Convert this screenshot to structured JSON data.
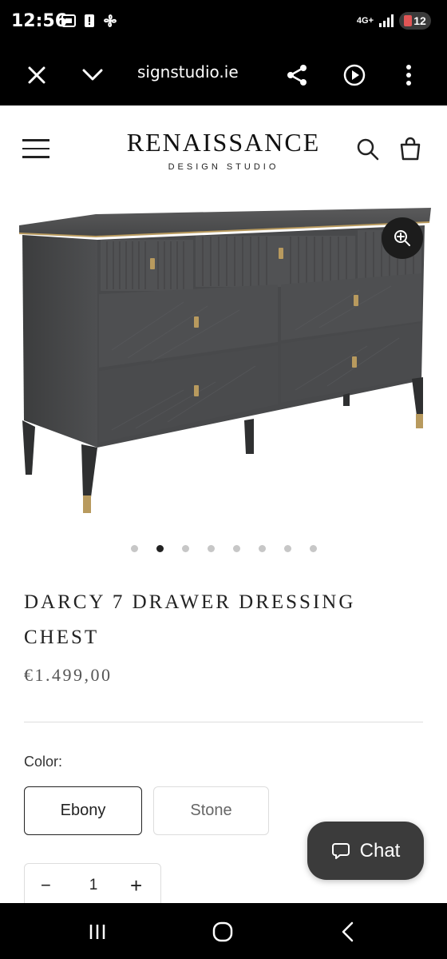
{
  "status_bar": {
    "time": "12:56",
    "network": "4G+",
    "battery_level": "12",
    "icons": [
      "screen-record-icon",
      "alert-icon",
      "fan-icon",
      "signal-icon",
      "battery-icon"
    ]
  },
  "browser": {
    "url_text": "signstudio.ie",
    "buttons": [
      "close-icon",
      "chevron-down-icon",
      "share-icon",
      "play-icon",
      "more-vertical-icon"
    ]
  },
  "header": {
    "brand_name": "RENAISSANCE",
    "brand_subtitle": "DESIGN STUDIO",
    "icons": [
      "menu-icon",
      "search-icon",
      "bag-icon"
    ]
  },
  "gallery": {
    "slide_count": 8,
    "active_slide": 2,
    "zoom_icon": "zoom-in-icon"
  },
  "product": {
    "title": "DARCY 7 DRAWER DRESSING CHEST",
    "price": "€1.499,00",
    "color_label": "Color:",
    "color_options": [
      "Ebony",
      "Stone"
    ],
    "selected_color": "Ebony",
    "quantity": "1",
    "qty_minus": "−",
    "qty_plus": "+"
  },
  "chat": {
    "label": "Chat",
    "icon": "chat-bubble-icon"
  },
  "nav": {
    "buttons": [
      "recent-apps-icon",
      "home-icon",
      "back-icon"
    ]
  },
  "colors": {
    "bars": "#000000",
    "chat_bg": "#3b3b3b",
    "text": "#222222",
    "price": "#555555",
    "furniture": "#4a4b4d",
    "brass": "#b89a5e"
  }
}
